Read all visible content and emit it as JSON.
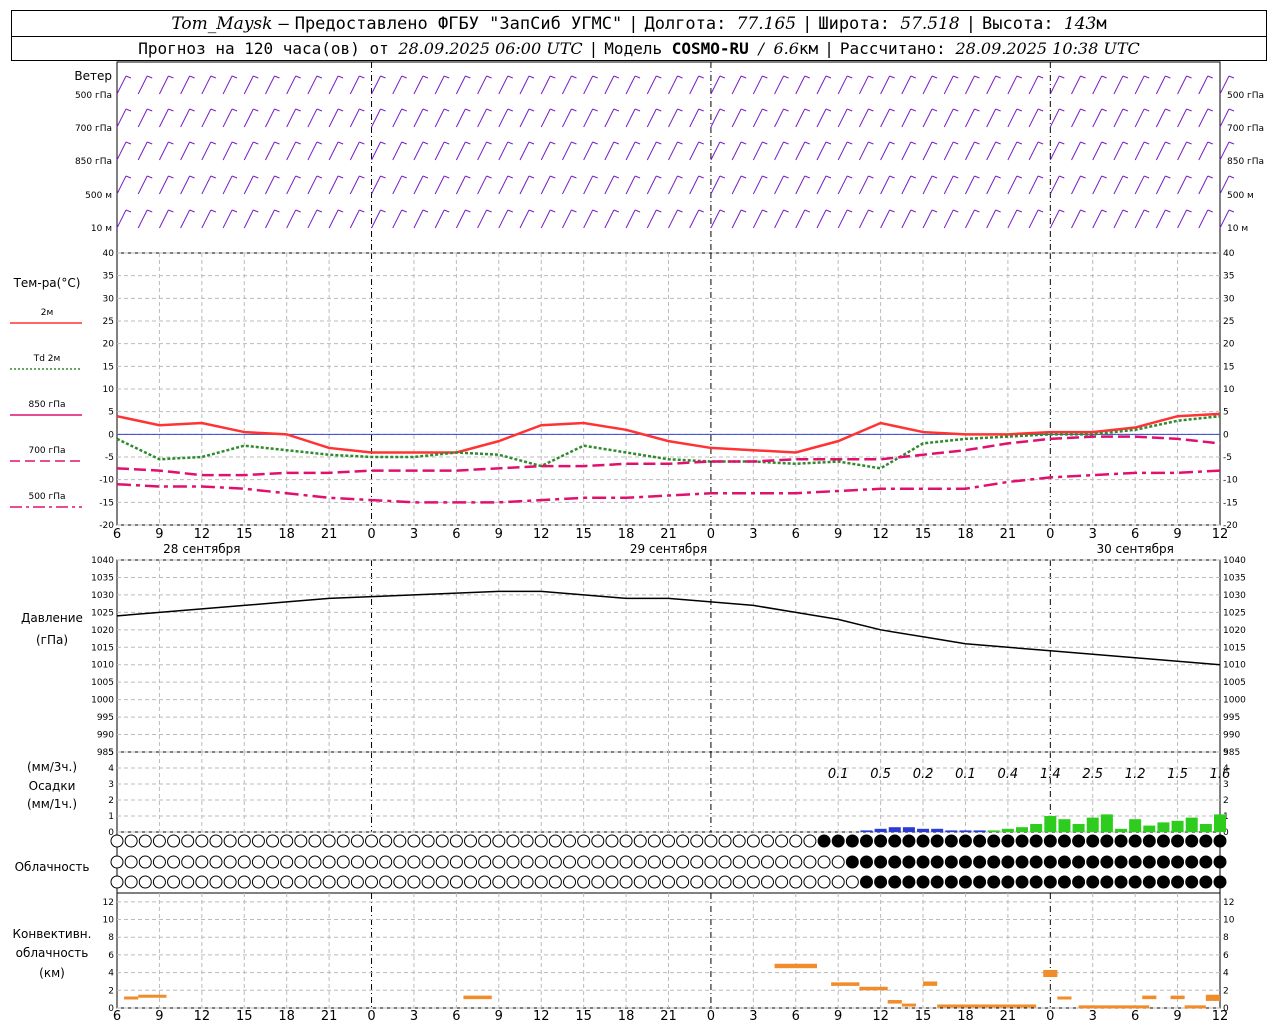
{
  "header": {
    "station": "Tom_Maysk",
    "dash": "–",
    "provider": "Предоставлено ФГБУ \"ЗапСиб УГМС\"",
    "lon_label": "Долгота:",
    "lon_value": "77.165",
    "lat_label": "Широта:",
    "lat_value": "57.518",
    "alt_label": "Высота:",
    "alt_value": "143",
    "alt_unit": "м",
    "forecast_label": "Прогноз на 120 часа(ов) от",
    "forecast_time": "28.09.2025 06:00 UTC",
    "model_label": "Модель",
    "model_name": "COSMO-RU",
    "model_res_sep": "/",
    "model_res": "6.6",
    "model_res_unit": "км",
    "calc_label": "Рассчитано:",
    "calc_time": "28.09.2025 10:38 UTC"
  },
  "wind_panel": {
    "title": "Ветер",
    "levels": [
      "500 гПа",
      "700 гПа",
      "850 гПа",
      "500 м",
      "10  м"
    ]
  },
  "temp_panel": {
    "title": "Тем-ра(°С)",
    "legend": [
      {
        "label": "2м",
        "color": "#ff3333",
        "style": "solid"
      },
      {
        "label": "Td  2м",
        "color": "#2e8b2e",
        "style": "dotted"
      },
      {
        "label": "850 гПа",
        "color": "#e0106e",
        "style": "solid"
      },
      {
        "label": "700 гПа",
        "color": "#e0106e",
        "style": "dash"
      },
      {
        "label": "500 гПа",
        "color": "#e0106e",
        "style": "dashdot"
      }
    ]
  },
  "pressure_panel": {
    "title": "Давление",
    "unit": "(гПа)"
  },
  "precip_panel": {
    "unit_top": "(мм/3ч.)",
    "title": "Осадки",
    "unit_bottom": "(мм/1ч.)"
  },
  "cloud_panel": {
    "title": "Облачность"
  },
  "conv_panel": {
    "title_1": "Конвективн.",
    "title_2": "облачность",
    "unit": "(км)"
  },
  "x_axis": {
    "hour_labels": [
      "6",
      "9",
      "12",
      "15",
      "18",
      "21",
      "0",
      "3",
      "6",
      "9",
      "12",
      "15",
      "18",
      "21",
      "0",
      "3",
      "6",
      "9",
      "12",
      "15",
      "18",
      "21",
      "0",
      "3",
      "6",
      "9",
      "12"
    ],
    "date_labels": [
      "28 сентября",
      "29 сентября",
      "30 сентября"
    ]
  },
  "colors": {
    "wind": "#7a1fc4",
    "temp2m": "#ff3333",
    "td2m": "#2e8b2e",
    "upper": "#e0106e",
    "pressure": "#000000",
    "rain_light": "#2a3bd4",
    "rain_heavy": "#2ecc1e",
    "convective": "#f08c2a",
    "zero_line": "#3344cc"
  },
  "chart_data": [
    {
      "type": "line",
      "title": "Тем-ра(°С)",
      "x_hours_from_start": [
        0,
        3,
        6,
        9,
        12,
        15,
        18,
        21,
        24,
        27,
        30,
        33,
        36,
        39,
        42,
        45,
        48,
        51,
        54,
        57,
        60,
        63,
        66,
        69,
        72,
        75,
        78
      ],
      "ylim": [
        -20,
        40
      ],
      "series": [
        {
          "name": "2м",
          "values": [
            4,
            2,
            2.5,
            0.5,
            0,
            -3,
            -4,
            -4,
            -4,
            -1.5,
            2,
            2.5,
            1,
            -1.5,
            -3,
            -3.5,
            -4,
            -1.5,
            2.5,
            0.5,
            0,
            0,
            0.5,
            0.5,
            1.5,
            4,
            4.5
          ]
        },
        {
          "name": "Td  2м",
          "values": [
            -1,
            -5.5,
            -5,
            -2.5,
            -3.5,
            -4.5,
            -5,
            -5,
            -4,
            -4.5,
            -7,
            -2.5,
            -4,
            -5.5,
            -6,
            -6,
            -6.5,
            -6,
            -7.5,
            -2,
            -1,
            -0.5,
            0,
            0,
            1,
            3,
            4
          ]
        },
        {
          "name": "850 гПа",
          "values": [
            -7.5,
            -8,
            -9,
            -9,
            -8.5,
            -8.5,
            -8,
            -8,
            -8,
            -7.5,
            -7,
            -7,
            -6.5,
            -6.5,
            -6,
            -6,
            -5.5,
            -5.5,
            -5.5,
            -4.5,
            -3.5,
            -2,
            -1,
            -0.5,
            -0.5,
            -1,
            -2
          ]
        },
        {
          "name": "500 гПа",
          "values": [
            -11,
            -11.5,
            -11.5,
            -12,
            -13,
            -14,
            -14.5,
            -15,
            -15,
            -15,
            -14.5,
            -14,
            -14,
            -13.5,
            -13,
            -13,
            -13,
            -12.5,
            -12,
            -12,
            -12,
            -10.5,
            -9.5,
            -9,
            -8.5,
            -8.5,
            -8
          ]
        }
      ]
    },
    {
      "type": "line",
      "title": "Давление",
      "ylabel": "(гПа)",
      "x_hours_from_start": [
        0,
        3,
        6,
        9,
        12,
        15,
        18,
        21,
        24,
        27,
        30,
        33,
        36,
        39,
        42,
        45,
        48,
        51,
        54,
        57,
        60,
        63,
        66,
        69,
        72,
        75,
        78
      ],
      "ylim": [
        985,
        1040
      ],
      "series": [
        {
          "name": "",
          "values": [
            1024,
            1025,
            1026,
            1027,
            1028,
            1029,
            1029.5,
            1030,
            1030.5,
            1031,
            1031,
            1030,
            1029,
            1029,
            1028,
            1027,
            1025,
            1023,
            1020,
            1018,
            1016,
            1015,
            1014,
            1013,
            1012,
            1011,
            1010
          ]
        }
      ]
    },
    {
      "type": "bar",
      "title": "Осадки",
      "ylabel": "(мм/3ч.) (мм/1ч.)",
      "ylim": [
        0,
        5
      ],
      "sum_labels_mm_per_3h": [
        "0.1",
        "0.5",
        "0.2",
        "0.1",
        "0.4",
        "1.4",
        "2.5",
        "1.2",
        "1.5",
        "1.6"
      ],
      "bars_mm_per_1h": {
        "x_hours_from_start": [
          53,
          54,
          55,
          56,
          57,
          58,
          59,
          60,
          61,
          62,
          63,
          64,
          65,
          66,
          67,
          68,
          69,
          70,
          71,
          72,
          73,
          74,
          75,
          76,
          77,
          78
        ],
        "values": [
          0.1,
          0.2,
          0.3,
          0.3,
          0.2,
          0.2,
          0.1,
          0.1,
          0.1,
          0.1,
          0.2,
          0.3,
          0.5,
          1.0,
          0.8,
          0.5,
          0.9,
          1.1,
          0.2,
          0.8,
          0.4,
          0.6,
          0.7,
          0.9,
          0.5,
          1.1
        ]
      }
    },
    {
      "type": "bar",
      "title": "Конвективн. облачность",
      "ylabel": "(км)",
      "ylim": [
        0,
        13
      ],
      "segments": [
        {
          "from": 0.5,
          "to": 1.5,
          "bottom": 1,
          "top": 1.3
        },
        {
          "from": 1.5,
          "to": 3.5,
          "bottom": 1.2,
          "top": 1.5
        },
        {
          "from": 24.5,
          "to": 26.5,
          "bottom": 1,
          "top": 1.4
        },
        {
          "from": 46.5,
          "to": 49.5,
          "bottom": 4.5,
          "top": 5
        },
        {
          "from": 50.5,
          "to": 52.5,
          "bottom": 2.5,
          "top": 2.9
        },
        {
          "from": 52.5,
          "to": 54.5,
          "bottom": 2,
          "top": 2.4
        },
        {
          "from": 54.5,
          "to": 55.5,
          "bottom": 0.5,
          "top": 0.9
        },
        {
          "from": 55.5,
          "to": 56.5,
          "bottom": 0.2,
          "top": 0.5
        },
        {
          "from": 57,
          "to": 58,
          "bottom": 2.5,
          "top": 3
        },
        {
          "from": 58,
          "to": 65,
          "bottom": 0.2,
          "top": 0.4
        },
        {
          "from": 65.5,
          "to": 66.5,
          "bottom": 3.5,
          "top": 4.3
        },
        {
          "from": 66.5,
          "to": 67.5,
          "bottom": 1,
          "top": 1.3
        },
        {
          "from": 68,
          "to": 73,
          "bottom": 0.1,
          "top": 0.3
        },
        {
          "from": 72.5,
          "to": 73.5,
          "bottom": 1,
          "top": 1.4
        },
        {
          "from": 74.5,
          "to": 75.5,
          "bottom": 1,
          "top": 1.4
        },
        {
          "from": 75.5,
          "to": 77,
          "bottom": 0.1,
          "top": 0.3
        },
        {
          "from": 77,
          "to": 78,
          "bottom": 0.8,
          "top": 1.5
        }
      ]
    }
  ]
}
